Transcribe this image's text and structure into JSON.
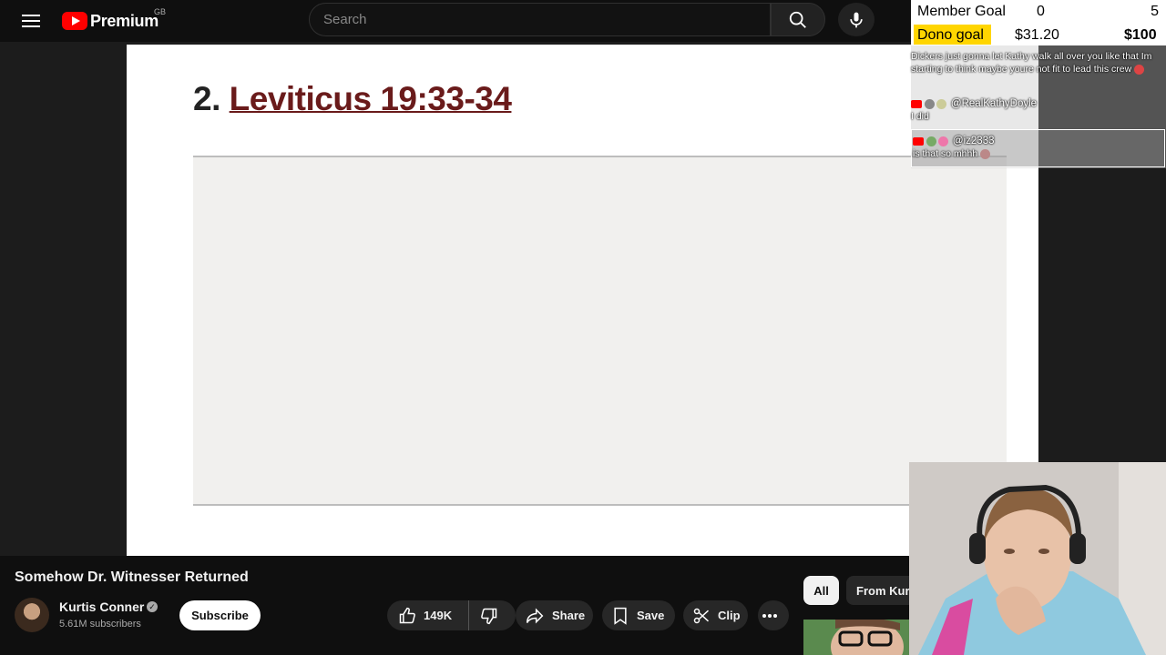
{
  "masthead": {
    "logo_text": "Premium",
    "region": "GB",
    "search_placeholder": "Search"
  },
  "slide": {
    "number": "2.",
    "reference": "Leviticus 19:33-34"
  },
  "overlay": {
    "member_goal": {
      "label": "Member Goal",
      "current": "0",
      "target": "5"
    },
    "dono_goal": {
      "label": "Dono goal",
      "current": "$31.20",
      "target": "$100"
    },
    "chat": [
      {
        "user": "",
        "message": "Dickers just gonna let Kathy walk all over you like that Im starting to think maybe youre not fit to lead this crew"
      },
      {
        "user": "@RealKathyDoyle",
        "message": "I did"
      },
      {
        "user": "@iz2333",
        "message": "is that so mhhh"
      }
    ]
  },
  "video": {
    "title": "Somehow Dr. Witnesser Returned",
    "channel": "Kurtis Conner",
    "subscribers": "5.61M subscribers",
    "subscribe_label": "Subscribe",
    "likes": "149K",
    "share_label": "Share",
    "save_label": "Save",
    "clip_label": "Clip"
  },
  "sidebar_chips": {
    "all": "All",
    "from": "From Kurt"
  },
  "colors": {
    "brand_red": "#ff0000",
    "dono_highlight": "#ffd500",
    "link_color": "#6a1b1b"
  }
}
